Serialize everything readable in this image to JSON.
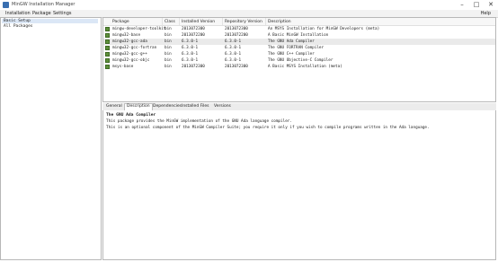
{
  "window": {
    "title": "MinGW Installation Manager",
    "minimize": "–",
    "maximize": "□",
    "close": "✕"
  },
  "menu": {
    "installation": "Installation",
    "package": "Package",
    "settings": "Settings",
    "help": "Help"
  },
  "left_panel": {
    "items": [
      "Basic Setup",
      "All Packages"
    ]
  },
  "package_table": {
    "columns": [
      "Package",
      "Class",
      "Installed Version",
      "Repository Version",
      "Description"
    ],
    "rows": [
      {
        "package": "mingw-developer-toolkit",
        "class": "bin",
        "installed": "2013072300",
        "repository": "2013072300",
        "description": "An MSYS Installation for MinGW Developers (meta)"
      },
      {
        "package": "mingw32-base",
        "class": "bin",
        "installed": "2013072200",
        "repository": "2013072200",
        "description": "A Basic MinGW Installation"
      },
      {
        "package": "mingw32-gcc-ada",
        "class": "bin",
        "installed": "6.3.0-1",
        "repository": "6.3.0-1",
        "description": "The GNU Ada Compiler"
      },
      {
        "package": "mingw32-gcc-fortran",
        "class": "bin",
        "installed": "6.3.0-1",
        "repository": "6.3.0-1",
        "description": "The GNU FORTRAN Compiler"
      },
      {
        "package": "mingw32-gcc-g++",
        "class": "bin",
        "installed": "6.3.0-1",
        "repository": "6.3.0-1",
        "description": "The GNU C++ Compiler"
      },
      {
        "package": "mingw32-gcc-objc",
        "class": "bin",
        "installed": "6.3.0-1",
        "repository": "6.3.0-1",
        "description": "The GNU Objective-C Compiler"
      },
      {
        "package": "msys-base",
        "class": "bin",
        "installed": "2013072300",
        "repository": "2013072300",
        "description": "A Basic MSYS Installation (meta)"
      }
    ]
  },
  "tabs": [
    "General",
    "Description",
    "Dependencies",
    "Installed Files",
    "Versions"
  ],
  "description_panel": {
    "title": "The GNU Ada Compiler",
    "lines": [
      "This package provides the MinGW implementation of the GNU Ada language compiler.",
      "This is an optional component of the MinGW Compiler Suite; you require it only if you wish to compile programs written in the Ada language."
    ]
  },
  "colors": {
    "checkbox": "#5d8f3a",
    "selected_row": "#eaeaea",
    "selected_left": "#dbe7f6"
  }
}
